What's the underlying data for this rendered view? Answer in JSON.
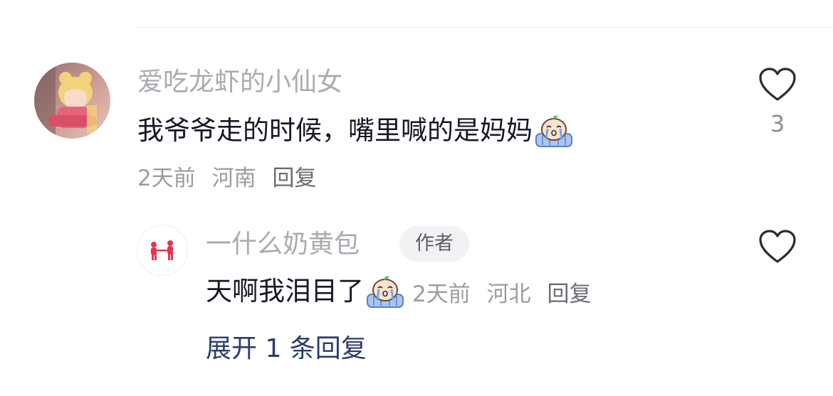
{
  "comment": {
    "username": "爱吃龙虾的小仙女",
    "text": "我爷爷走的时候，嘴里喊的是妈妈",
    "emoji": "crying-emoji",
    "time": "2天前",
    "location": "河南",
    "reply_label": "回复",
    "like_count": "3",
    "like_icon": "heart-outline-icon"
  },
  "reply": {
    "username": "一什么奶黄包",
    "author_tag": "作者",
    "text": "天啊我泪目了",
    "emoji": "crying-emoji",
    "time": "2天前",
    "location": "河北",
    "reply_label": "回复",
    "like_icon": "heart-outline-icon"
  },
  "expand_replies": "展开 1 条回复",
  "colors": {
    "username": "#a9abb0",
    "text": "#161823",
    "meta": "#9a9ca1",
    "expand": "#2d3a6e",
    "tag_bg": "#f2f2f4"
  }
}
